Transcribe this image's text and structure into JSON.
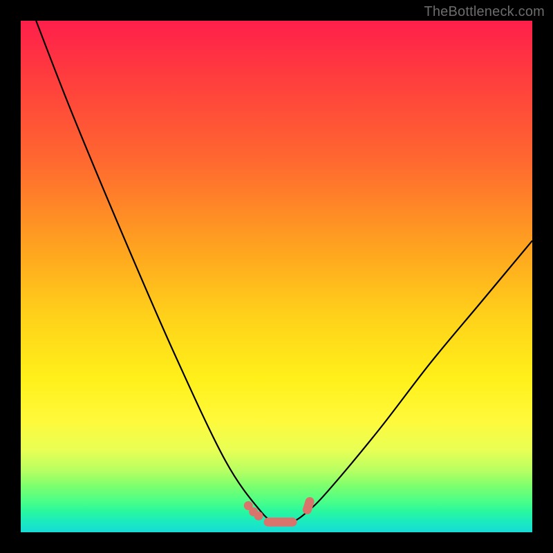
{
  "watermark": "TheBottleneck.com",
  "chart_data": {
    "type": "line",
    "title": "",
    "xlabel": "",
    "ylabel": "",
    "xlim": [
      0,
      100
    ],
    "ylim": [
      0,
      100
    ],
    "grid": false,
    "legend": false,
    "series": [
      {
        "name": "bottleneck-curve",
        "color": "#000000",
        "x": [
          3,
          10,
          20,
          30,
          40,
          47,
          50,
          53,
          56,
          60,
          70,
          80,
          90,
          100
        ],
        "y": [
          100,
          82,
          58,
          35,
          14,
          4,
          2,
          2,
          4,
          8,
          20,
          33,
          45,
          57
        ]
      },
      {
        "name": "optimal-marker",
        "color": "#d9746c",
        "style": "capsule",
        "x": [
          44.5,
          45.5,
          46.5,
          50.5,
          56.0,
          56.5
        ],
        "y": [
          5.2,
          4.0,
          3.2,
          2.0,
          4.4,
          6.0
        ]
      }
    ],
    "background_gradient": {
      "top": "#ff1f4b",
      "upper_mid": "#ffa51f",
      "mid": "#fff01a",
      "lower_mid": "#7cff6e",
      "bottom": "#17dcd6"
    }
  }
}
